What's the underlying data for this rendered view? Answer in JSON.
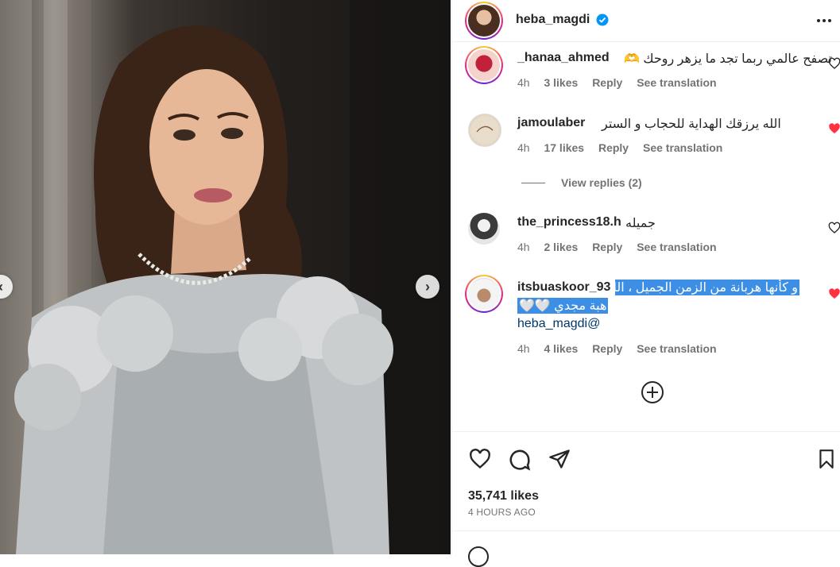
{
  "post": {
    "author": "heba_magdi",
    "verified": true,
    "more_icon": "more-horizontal-icon"
  },
  "comments": [
    {
      "username": "_hanaa_ahmed",
      "text": "تصفح عالمي ربما تجد ما يزهر روحك 🫶",
      "time": "4h",
      "likes": "3 likes",
      "reply": "Reply",
      "translate": "See translation",
      "liked": false
    },
    {
      "username": "jamoulaber",
      "text": "الله يرزقك الهداية للحجاب و الستر",
      "time": "4h",
      "likes": "17 likes",
      "reply": "Reply",
      "translate": "See translation",
      "liked": true,
      "view_replies": "View replies (2)"
    },
    {
      "username": "the_princess18.h",
      "text": "جميله",
      "time": "4h",
      "likes": "2 likes",
      "reply": "Reply",
      "translate": "See translation",
      "liked": false
    },
    {
      "username": "itsbuaskoor_93",
      "text_line1": "و كأنها هربانة من الزمن الجميل ، الليدي",
      "text_line2": "هبة مجدي 🤍🤍",
      "mention": "heba_magdi@",
      "time": "4h",
      "likes": "4 likes",
      "reply": "Reply",
      "translate": "See translation",
      "liked": true
    }
  ],
  "load_more_icon": "plus-circle-icon",
  "actions": {
    "likes": "35,741 likes",
    "timestamp": "4 HOURS AGO"
  },
  "colors": {
    "liked": "#ff3040",
    "link": "#00376b",
    "selection": "#3d8fe6",
    "muted": "#737373"
  }
}
